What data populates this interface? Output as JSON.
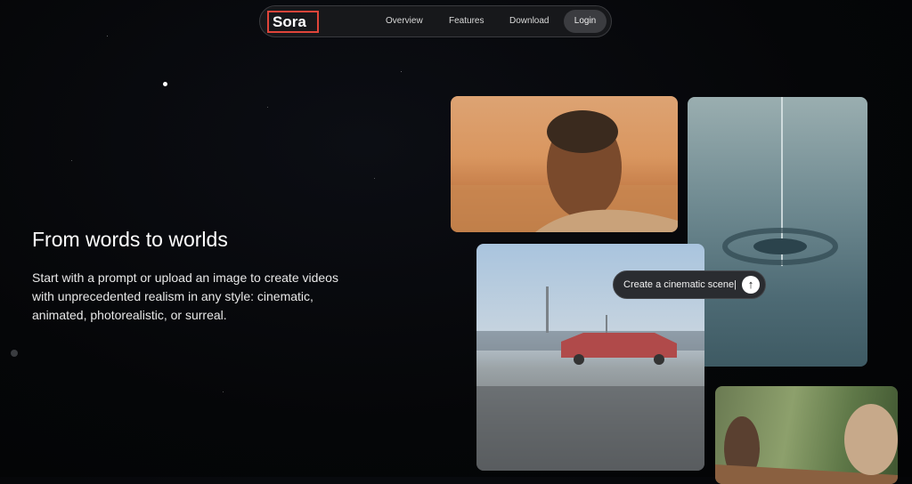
{
  "nav": {
    "logo": "Sora",
    "links": [
      "Overview",
      "Features",
      "Download"
    ],
    "login": "Login"
  },
  "hero": {
    "headline": "From words to worlds",
    "subtext": "Start with a prompt or upload an image to create videos with unprecedented realism in any style: cinematic, animated, photorealistic, or surreal."
  },
  "prompt_box": {
    "text": "Create a cinematic scene|",
    "icon": "arrow-up-icon"
  },
  "colors": {
    "background": "#050608",
    "logo_outline": "#e0453a",
    "nav_bg": "#17181b"
  }
}
